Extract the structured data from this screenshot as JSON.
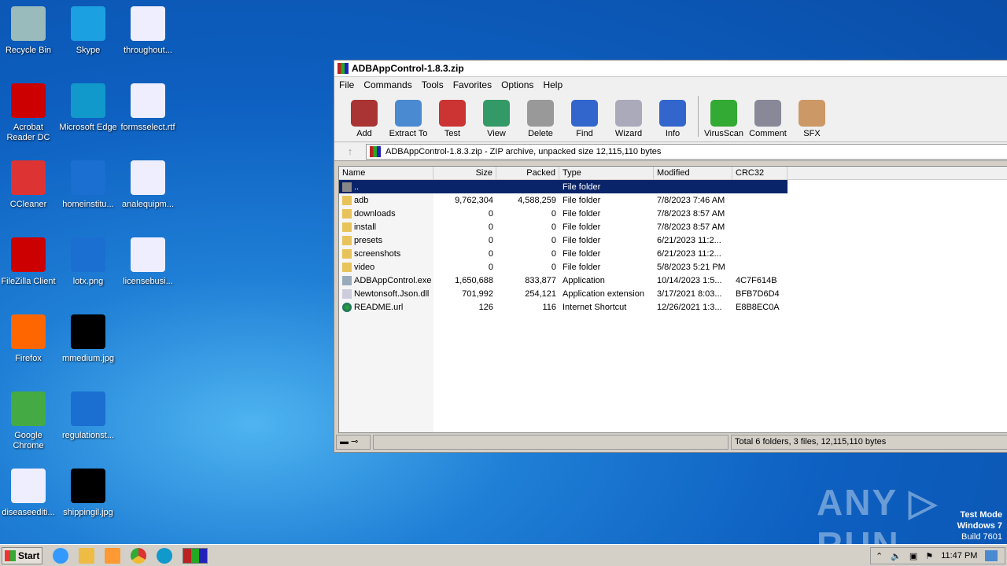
{
  "desktop": {
    "icons": [
      {
        "label": "Recycle Bin",
        "color": "#9bb"
      },
      {
        "label": "Skype",
        "color": "#1ba1e2"
      },
      {
        "label": "throughout...",
        "color": "#eef"
      },
      {
        "label": "Acrobat Reader DC",
        "color": "#c00"
      },
      {
        "label": "Microsoft Edge",
        "color": "#19c"
      },
      {
        "label": "formsselect.rtf",
        "color": "#eef"
      },
      {
        "label": "CCleaner",
        "color": "#d33"
      },
      {
        "label": "homeinstitu...",
        "color": "#1a6fd0"
      },
      {
        "label": "analequipm...",
        "color": "#eef"
      },
      {
        "label": "FileZilla Client",
        "color": "#c00"
      },
      {
        "label": "lotx.png",
        "color": "#1a6fd0"
      },
      {
        "label": "licensebusi...",
        "color": "#eef"
      },
      {
        "label": "Firefox",
        "color": "#f60"
      },
      {
        "label": "mmedium.jpg",
        "color": "#000"
      },
      {
        "label": "Google Chrome",
        "color": "#4a4"
      },
      {
        "label": "regulationst...",
        "color": "#1a6fd0"
      },
      {
        "label": "diseaseediti...",
        "color": "#eef"
      },
      {
        "label": "shippingil.jpg",
        "color": "#000"
      }
    ]
  },
  "window": {
    "title": "ADBAppControl-1.8.3.zip",
    "menu": [
      "File",
      "Commands",
      "Tools",
      "Favorites",
      "Options",
      "Help"
    ],
    "toolbar": [
      {
        "label": "Add",
        "color": "#a33"
      },
      {
        "label": "Extract To",
        "color": "#4a8ad0"
      },
      {
        "label": "Test",
        "color": "#c33"
      },
      {
        "label": "View",
        "color": "#396"
      },
      {
        "label": "Delete",
        "color": "#999"
      },
      {
        "label": "Find",
        "color": "#36c"
      },
      {
        "label": "Wizard",
        "color": "#aab"
      },
      {
        "label": "Info",
        "color": "#36c"
      },
      {
        "label": "VirusScan",
        "color": "#3a3"
      },
      {
        "label": "Comment",
        "color": "#889"
      },
      {
        "label": "SFX",
        "color": "#c96"
      }
    ],
    "address": "ADBAppControl-1.8.3.zip - ZIP archive, unpacked size 12,115,110 bytes",
    "columns": [
      "Name",
      "Size",
      "Packed",
      "Type",
      "Modified",
      "CRC32"
    ],
    "rows": [
      {
        "name": "..",
        "size": "",
        "packed": "",
        "type": "File folder",
        "modified": "",
        "crc": "",
        "icon": "up"
      },
      {
        "name": "adb",
        "size": "9,762,304",
        "packed": "4,588,259",
        "type": "File folder",
        "modified": "7/8/2023 7:46 AM",
        "crc": "",
        "icon": "folder"
      },
      {
        "name": "downloads",
        "size": "0",
        "packed": "0",
        "type": "File folder",
        "modified": "7/8/2023 8:57 AM",
        "crc": "",
        "icon": "folder"
      },
      {
        "name": "install",
        "size": "0",
        "packed": "0",
        "type": "File folder",
        "modified": "7/8/2023 8:57 AM",
        "crc": "",
        "icon": "folder"
      },
      {
        "name": "presets",
        "size": "0",
        "packed": "0",
        "type": "File folder",
        "modified": "6/21/2023 11:2...",
        "crc": "",
        "icon": "folder"
      },
      {
        "name": "screenshots",
        "size": "0",
        "packed": "0",
        "type": "File folder",
        "modified": "6/21/2023 11:2...",
        "crc": "",
        "icon": "folder"
      },
      {
        "name": "video",
        "size": "0",
        "packed": "0",
        "type": "File folder",
        "modified": "5/8/2023 5:21 PM",
        "crc": "",
        "icon": "folder"
      },
      {
        "name": "ADBAppControl.exe",
        "size": "1,650,688",
        "packed": "833,877",
        "type": "Application",
        "modified": "10/14/2023 1:5...",
        "crc": "4C7F614B",
        "icon": "exe"
      },
      {
        "name": "Newtonsoft.Json.dll",
        "size": "701,992",
        "packed": "254,121",
        "type": "Application extension",
        "modified": "3/17/2021 8:03...",
        "crc": "BFB7D6D4",
        "icon": "dll"
      },
      {
        "name": "README.url",
        "size": "126",
        "packed": "116",
        "type": "Internet Shortcut",
        "modified": "12/26/2021 1:3...",
        "crc": "E8B8EC0A",
        "icon": "url"
      }
    ],
    "status": "Total 6 folders, 3 files, 12,115,110 bytes"
  },
  "watermark": {
    "brand": "ANY RUN",
    "line1": "Test Mode",
    "line2": "Windows 7",
    "line3": "Build 7601"
  },
  "taskbar": {
    "start": "Start",
    "clock": "11:47 PM"
  }
}
